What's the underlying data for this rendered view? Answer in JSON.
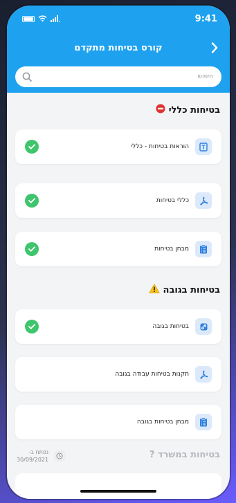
{
  "status_bar": {
    "time": "9:41"
  },
  "header": {
    "title": "קורס בטיחות מתקדם"
  },
  "search": {
    "placeholder": "חיפוש"
  },
  "sections": [
    {
      "title": "בטיחות כללי",
      "emoji": "⛔",
      "items": [
        {
          "label": "הוראות בטיחות - כללי",
          "icon": "document-icon",
          "completed": true
        },
        {
          "label": "כללי בטיחות",
          "icon": "pdf-icon",
          "completed": true
        },
        {
          "label": "מבחן בטיחות",
          "icon": "quiz-clipboard-icon",
          "completed": true
        }
      ]
    },
    {
      "title": "בטיחות בגובה",
      "emoji": "⚠️",
      "items": [
        {
          "label": "בטיחות בגובה",
          "icon": "link-icon",
          "completed": true
        },
        {
          "label": "תקנות בטיחות עבודה בגובה",
          "icon": "pdf-icon",
          "completed": false
        },
        {
          "label": "מבחן בטיחות בגובה",
          "icon": "quiz-clipboard-icon",
          "completed": false
        }
      ]
    },
    {
      "title": "בטיחות במשרד ?",
      "opens_label": "נפתח ב-",
      "opens_date": "30/09/2021"
    }
  ],
  "colors": {
    "header": "#1ea2ef",
    "check": "#3fc56d",
    "icon_bg": "#dbe9fb",
    "icon_fg": "#2d7fe0"
  }
}
